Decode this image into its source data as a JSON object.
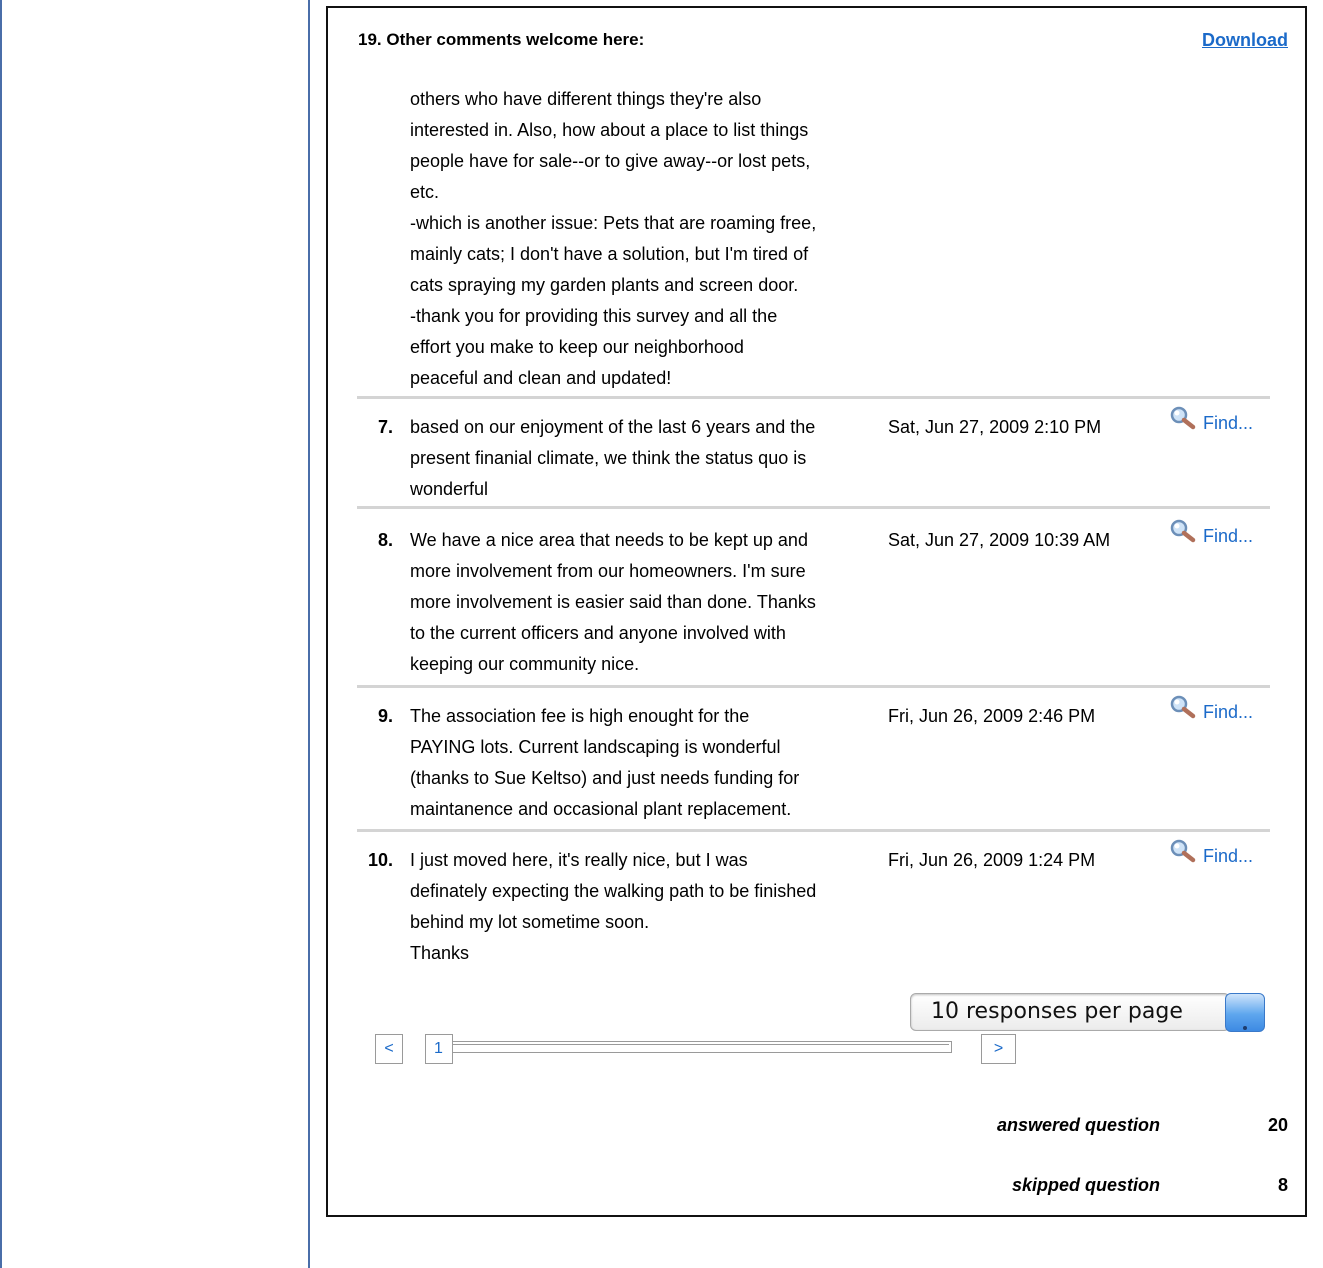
{
  "question": {
    "title": "19. Other comments welcome here:",
    "download_label": "Download"
  },
  "continued_response": [
    "others who have different things they're also",
    "interested in. Also, how about a place to list things",
    "people have for sale--or to give away--or lost pets,",
    "etc.",
    "-which is another issue: Pets that are roaming free,",
    "mainly cats; I don't have a solution, but I'm tired of",
    "cats spraying my garden plants and screen door.",
    "-thank you for providing this survey and all the",
    "effort you make to keep our neighborhood",
    "peaceful and clean and updated!"
  ],
  "responses": [
    {
      "num": "7.",
      "lines": [
        "based on our enjoyment of the last 6 years and the",
        "present finanial climate, we think the status quo is",
        "wonderful"
      ],
      "date": "Sat, Jun 27, 2009 2:10 PM",
      "find": "Find..."
    },
    {
      "num": "8.",
      "lines": [
        "We have a nice area that needs to be kept up and",
        "more involvement from our homeowners. I'm sure",
        "more involvement is easier said than done. Thanks",
        "to the current officers and anyone involved with",
        "keeping our community nice."
      ],
      "date": "Sat, Jun 27, 2009 10:39 AM",
      "find": "Find..."
    },
    {
      "num": "9.",
      "lines": [
        "The association fee is high enought for the",
        "PAYING lots. Current landscaping is wonderful",
        "(thanks to Sue Keltso) and just needs funding for",
        "maintanence and occasional plant replacement."
      ],
      "date": "Fri, Jun 26, 2009 2:46 PM",
      "find": "Find..."
    },
    {
      "num": "10.",
      "lines": [
        "I just moved here, it's really nice, but I was",
        "definately expecting the walking path to be finished",
        "behind my lot sometime soon.",
        "Thanks"
      ],
      "date": "Fri, Jun 26, 2009 1:24 PM",
      "find": "Find..."
    }
  ],
  "pagination": {
    "per_page_label": "10 responses per page",
    "prev": "<",
    "page": "1",
    "next": ">"
  },
  "stats": {
    "answered_label": "answered question",
    "answered_value": "20",
    "skipped_label": "skipped question",
    "skipped_value": "8"
  },
  "icons": {
    "find": "magnifier-icon"
  },
  "colors": {
    "link": "#1b6ac9",
    "sidebar_border": "#4a6ea9"
  }
}
